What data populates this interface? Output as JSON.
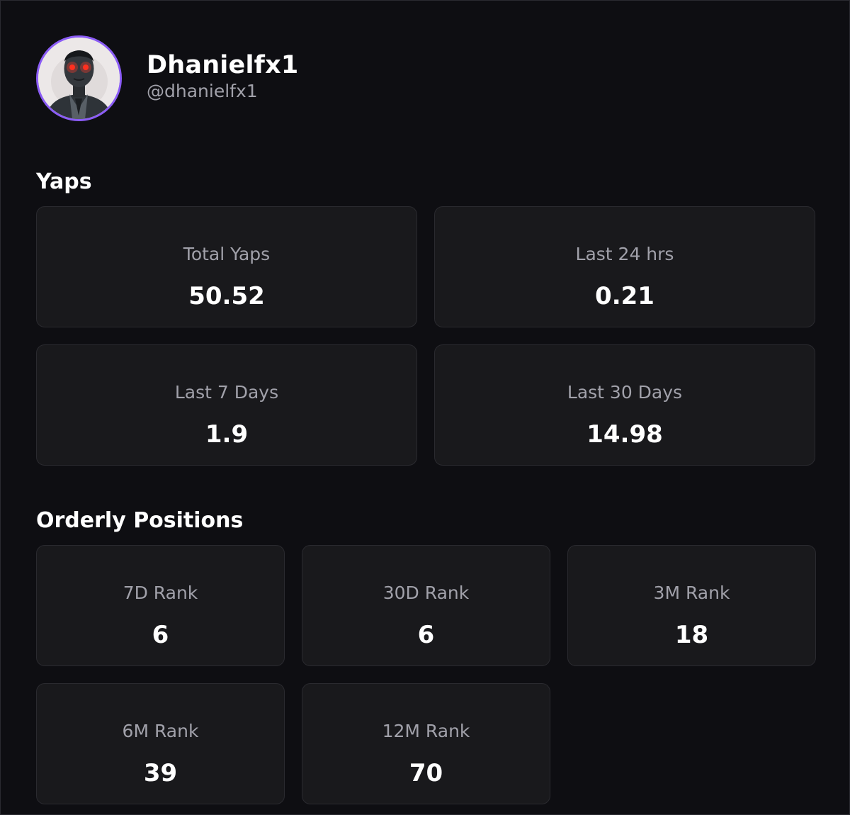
{
  "profile": {
    "display_name": "Dhanielfx1",
    "handle": "@dhanielfx1",
    "avatar_icon": "user-avatar",
    "avatar_ring_color": "#8b5cf6"
  },
  "yaps": {
    "title": "Yaps",
    "cards": [
      {
        "label": "Total Yaps",
        "value": "50.52"
      },
      {
        "label": "Last 24 hrs",
        "value": "0.21"
      },
      {
        "label": "Last 7 Days",
        "value": "1.9"
      },
      {
        "label": "Last 30 Days",
        "value": "14.98"
      }
    ]
  },
  "positions": {
    "title": "Orderly Positions",
    "cards": [
      {
        "label": "7D Rank",
        "value": "6"
      },
      {
        "label": "30D Rank",
        "value": "6"
      },
      {
        "label": "3M Rank",
        "value": "18"
      },
      {
        "label": "6M Rank",
        "value": "39"
      },
      {
        "label": "12M Rank",
        "value": "70"
      }
    ]
  }
}
